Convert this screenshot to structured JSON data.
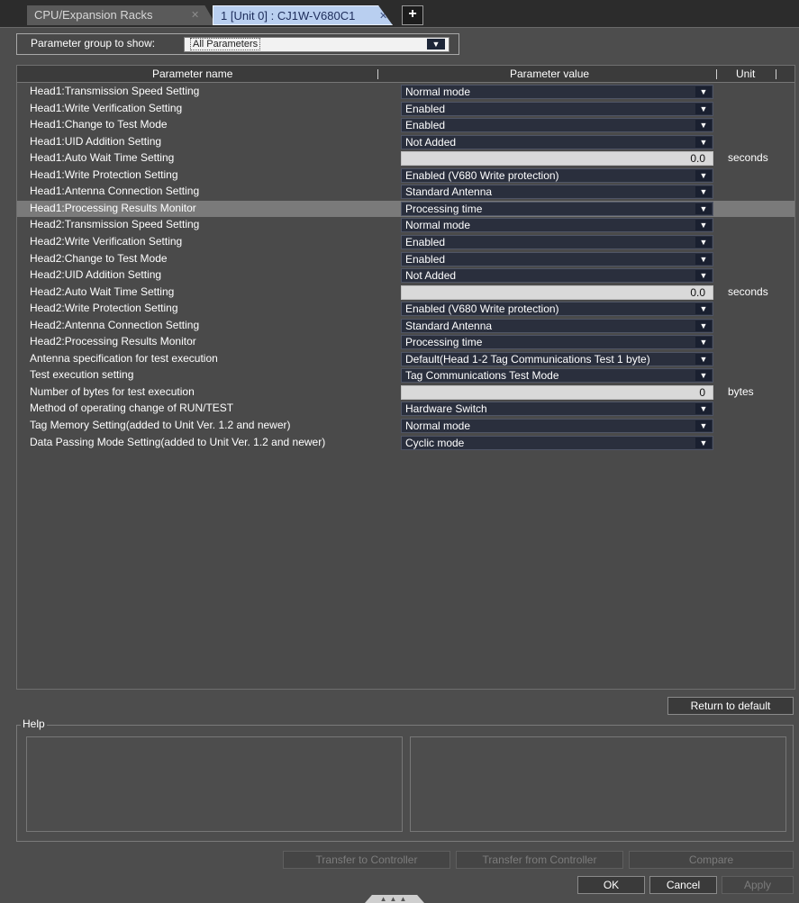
{
  "tabs": [
    {
      "label": "CPU/Expansion Racks",
      "active": false
    },
    {
      "label": "1 [Unit 0] : CJ1W-V680C1",
      "active": true
    }
  ],
  "filter": {
    "label": "Parameter group to show:",
    "value": "All Parameters"
  },
  "columns": {
    "name": "Parameter name",
    "value": "Parameter value",
    "unit": "Unit"
  },
  "rows": [
    {
      "name": "Head1:Transmission Speed Setting",
      "value": "Normal mode",
      "kind": "dd",
      "unit": ""
    },
    {
      "name": "Head1:Write Verification Setting",
      "value": "Enabled",
      "kind": "dd",
      "unit": ""
    },
    {
      "name": "Head1:Change to Test Mode",
      "value": "Enabled",
      "kind": "dd",
      "unit": ""
    },
    {
      "name": "Head1:UID Addition Setting",
      "value": "Not Added",
      "kind": "dd",
      "unit": ""
    },
    {
      "name": "Head1:Auto Wait Time Setting",
      "value": "0.0",
      "kind": "num",
      "unit": "seconds"
    },
    {
      "name": "Head1:Write Protection Setting",
      "value": "Enabled (V680 Write protection)",
      "kind": "dd",
      "unit": ""
    },
    {
      "name": "Head1:Antenna Connection Setting",
      "value": "Standard Antenna",
      "kind": "dd",
      "unit": ""
    },
    {
      "name": "Head1:Processing Results Monitor",
      "value": "Processing time",
      "kind": "dd",
      "unit": "",
      "selected": true
    },
    {
      "name": "Head2:Transmission Speed Setting",
      "value": "Normal mode",
      "kind": "dd",
      "unit": ""
    },
    {
      "name": "Head2:Write Verification Setting",
      "value": "Enabled",
      "kind": "dd",
      "unit": ""
    },
    {
      "name": "Head2:Change to Test Mode",
      "value": "Enabled",
      "kind": "dd",
      "unit": ""
    },
    {
      "name": "Head2:UID Addition Setting",
      "value": "Not Added",
      "kind": "dd",
      "unit": ""
    },
    {
      "name": "Head2:Auto Wait Time Setting",
      "value": "0.0",
      "kind": "num",
      "unit": "seconds"
    },
    {
      "name": "Head2:Write Protection Setting",
      "value": "Enabled (V680 Write protection)",
      "kind": "dd",
      "unit": ""
    },
    {
      "name": "Head2:Antenna Connection Setting",
      "value": "Standard Antenna",
      "kind": "dd",
      "unit": ""
    },
    {
      "name": "Head2:Processing Results Monitor",
      "value": "Processing time",
      "kind": "dd",
      "unit": ""
    },
    {
      "name": "Antenna specification for test execution",
      "value": "Default(Head 1-2 Tag Communications Test 1 byte)",
      "kind": "dd",
      "unit": ""
    },
    {
      "name": "Test execution setting",
      "value": "Tag Communications Test Mode",
      "kind": "dd",
      "unit": ""
    },
    {
      "name": "Number of bytes for test execution",
      "value": "0",
      "kind": "num",
      "unit": "bytes"
    },
    {
      "name": "Method of operating change of RUN/TEST",
      "value": "Hardware Switch",
      "kind": "dd",
      "unit": ""
    },
    {
      "name": "Tag Memory Setting(added to Unit Ver. 1.2 and newer)",
      "value": "Normal mode",
      "kind": "dd",
      "unit": ""
    },
    {
      "name": "Data Passing Mode Setting(added to Unit Ver. 1.2 and newer)",
      "value": "Cyclic mode",
      "kind": "dd",
      "unit": ""
    }
  ],
  "buttons": {
    "return_default": "Return to default",
    "transfer_to": "Transfer to Controller",
    "transfer_from": "Transfer from Controller",
    "compare": "Compare",
    "ok": "OK",
    "cancel": "Cancel",
    "apply": "Apply"
  },
  "help": {
    "label": "Help"
  },
  "icons": {
    "tab_close": "close-icon",
    "add_tab": "plus-icon",
    "dropdown": "dropdown-arrow-icon"
  }
}
